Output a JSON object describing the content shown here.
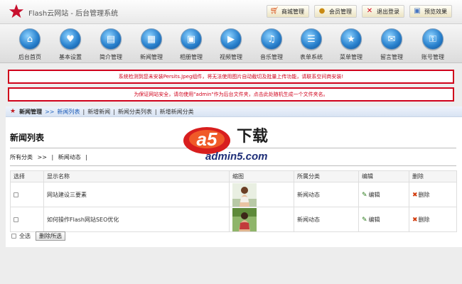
{
  "header": {
    "brand": "Flash云网站 - 后台管理系统",
    "links": [
      {
        "label": "商城管理",
        "icon": "cart-icon"
      },
      {
        "label": "会员管理",
        "icon": "user-icon"
      },
      {
        "label": "退出登录",
        "icon": "close-icon"
      },
      {
        "label": "预览效果",
        "icon": "preview-icon"
      }
    ]
  },
  "nav": {
    "items": [
      {
        "label": "后台首页",
        "icon": "home-icon",
        "glyph": "⌂"
      },
      {
        "label": "基本设置",
        "icon": "heart-icon",
        "glyph": "♥"
      },
      {
        "label": "简介管理",
        "icon": "document-icon",
        "glyph": "▤"
      },
      {
        "label": "新闻管理",
        "icon": "news-icon",
        "glyph": "▦"
      },
      {
        "label": "相册管理",
        "icon": "photo-icon",
        "glyph": "▣"
      },
      {
        "label": "视频管理",
        "icon": "video-icon",
        "glyph": "▶"
      },
      {
        "label": "音乐管理",
        "icon": "music-icon",
        "glyph": "♫"
      },
      {
        "label": "表单系统",
        "icon": "form-icon",
        "glyph": "☰"
      },
      {
        "label": "菜单管理",
        "icon": "star-icon",
        "glyph": "★"
      },
      {
        "label": "留言管理",
        "icon": "message-icon",
        "glyph": "✉"
      },
      {
        "label": "账号管理",
        "icon": "key-icon",
        "glyph": "⚿"
      }
    ]
  },
  "alerts": {
    "first": "系统检测到您未安装Persits.Jpeg组件，将无法使用图片自动截切及批量上传功能，请联系空间商安装!",
    "second": "为保证网站安全，请勿使用\"admin\"作为后台文件夹，点击此处随机生成一个文件夹名。"
  },
  "breadcrumb": {
    "root": "新闻管理",
    "arrow": ">>",
    "current": "新闻列表",
    "links": [
      "新增新闻",
      "新闻分类列表",
      "新增新闻分类"
    ]
  },
  "page": {
    "title": "新闻列表",
    "categories": {
      "all": "所有分类",
      "arrow": ">>",
      "current": "新闻动态"
    }
  },
  "table": {
    "headers": [
      "选择",
      "显示名称",
      "缩图",
      "所属分类",
      "编辑",
      "删除"
    ],
    "rows": [
      {
        "name": "网站建设三要素",
        "category": "新闻动态",
        "edit": "编辑",
        "delete": "删除"
      },
      {
        "name": "如何操作Flash网站SEO优化",
        "category": "新闻动态",
        "edit": "编辑",
        "delete": "删除"
      }
    ]
  },
  "footer": {
    "select_all": "全选",
    "delete_selected": "删除所选"
  },
  "watermark": {
    "logo_text": "a5",
    "cn": "下载",
    "domain": "admin5.com"
  },
  "colors": {
    "alert": "#d0021b",
    "link": "#1a5bb8",
    "nav_icon": "#2b83cf"
  }
}
